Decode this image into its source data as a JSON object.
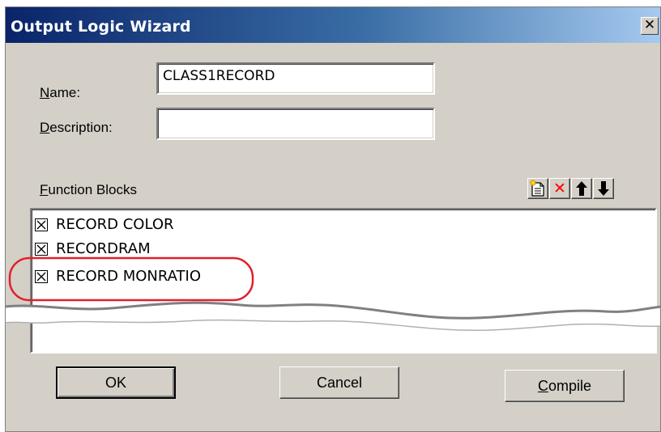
{
  "window": {
    "title": "Output Logic Wizard",
    "close_glyph": "✕"
  },
  "form": {
    "name_label_key": "N",
    "name_label_rest": "ame:",
    "name_value": "CLASS1RECORD",
    "description_label_key": "D",
    "description_label_rest": "escription:",
    "description_value": ""
  },
  "function_blocks": {
    "label_key": "F",
    "label_rest": "unction Blocks",
    "toolbar": {
      "new_icon": "new-document-icon",
      "delete_glyph": "✕",
      "up_glyph": "🡑",
      "down_glyph": "🡓",
      "delete_color": "#ff0000"
    },
    "items": [
      {
        "label": "RECORD COLOR",
        "checked": true
      },
      {
        "label": "RECORDRAM",
        "checked": true
      },
      {
        "label": "RECORD MONRATIO",
        "checked": true
      }
    ],
    "highlight_color": "#e0202a"
  },
  "buttons": {
    "ok": "OK",
    "cancel": "Cancel",
    "compile_key": "C",
    "compile_rest": "ompile"
  }
}
